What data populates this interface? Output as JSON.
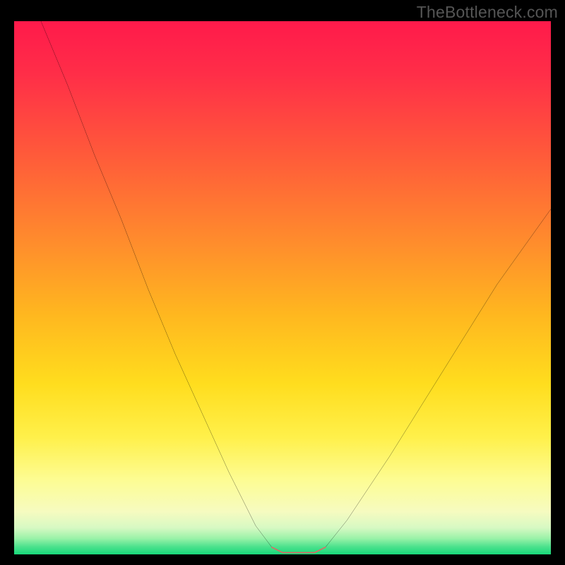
{
  "watermark": "TheBottleneck.com",
  "chart_data": {
    "type": "line",
    "title": "",
    "xlabel": "",
    "ylabel": "",
    "xlim": [
      0,
      100
    ],
    "ylim": [
      0,
      100
    ],
    "grid": false,
    "notes": "Two unlabeled black curves over a vertical red→green gradient. The left curve descends steeply from upper-left to a flat minimum near x≈48–58 (highlighted with a thick salmon segment), and the right curve rises more gently toward the upper-right. No numeric axes or ticks are shown; x and y are normalized 0–100. Values are estimated from pixel positions.",
    "series": [
      {
        "name": "left-descending-curve",
        "x": [
          5,
          10,
          15,
          20,
          25,
          30,
          35,
          40,
          45,
          48
        ],
        "y": [
          100,
          88,
          75,
          63,
          50,
          38,
          27,
          16,
          6,
          2
        ]
      },
      {
        "name": "trough-highlight",
        "x": [
          48,
          50,
          52,
          54,
          56,
          58
        ],
        "y": [
          2,
          1,
          1,
          1,
          1,
          2
        ]
      },
      {
        "name": "right-ascending-curve",
        "x": [
          58,
          62,
          66,
          70,
          75,
          80,
          85,
          90,
          95,
          100
        ],
        "y": [
          2,
          7,
          13,
          19,
          27,
          35,
          43,
          51,
          58,
          65
        ]
      }
    ],
    "colors": {
      "curve": "#000000",
      "highlight": "#e06666",
      "gradient_top": "#ff1a4b",
      "gradient_bottom": "#17d879"
    }
  }
}
